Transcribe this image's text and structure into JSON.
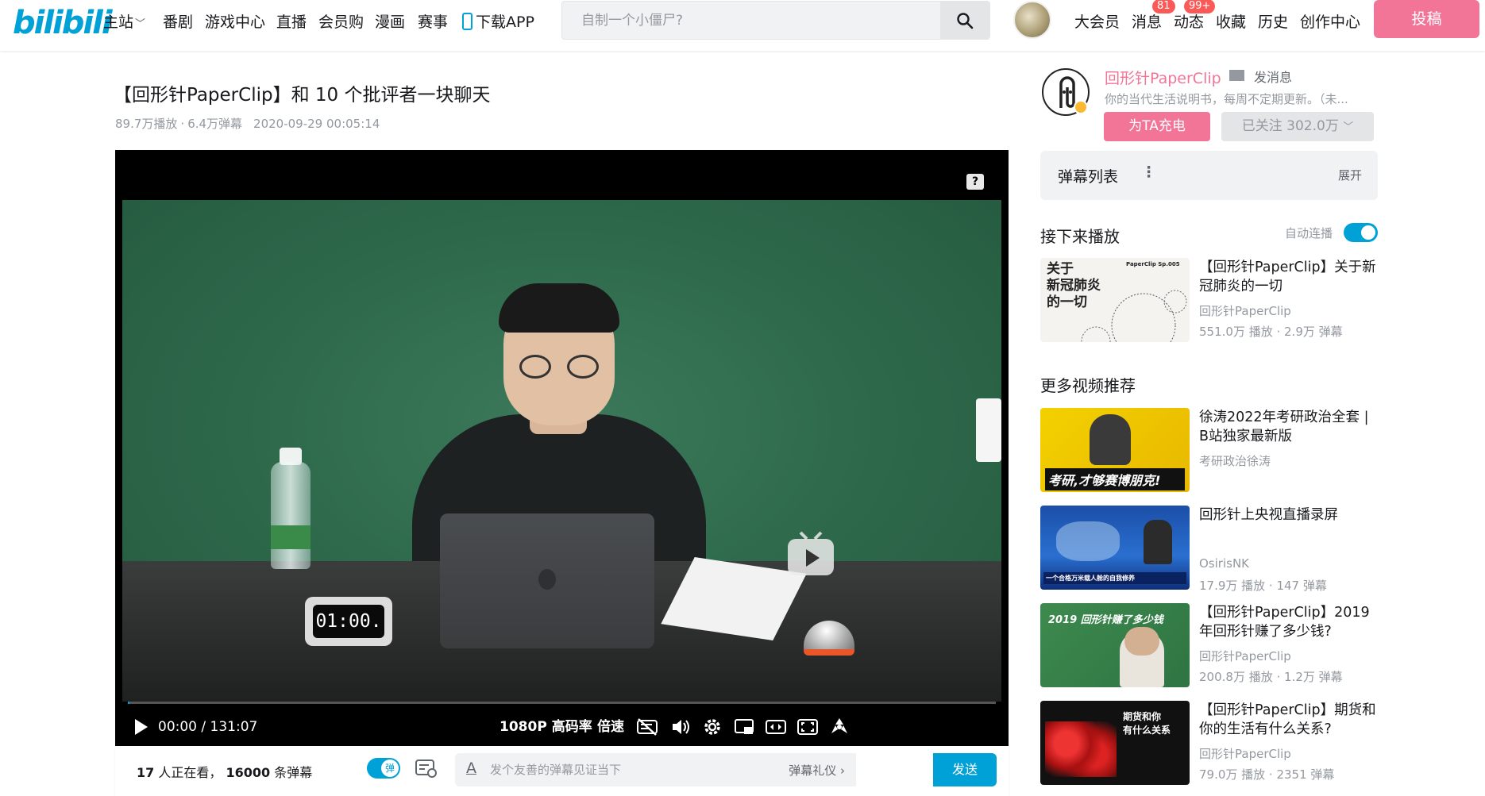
{
  "header": {
    "logo": "bilibili",
    "nav": [
      {
        "label": "主站",
        "has_caret": true
      },
      {
        "label": "番剧"
      },
      {
        "label": "游戏中心"
      },
      {
        "label": "直播"
      },
      {
        "label": "会员购"
      },
      {
        "label": "漫画"
      },
      {
        "label": "赛事"
      },
      {
        "label": "下载APP"
      }
    ],
    "search_placeholder": "自制一个小僵尸?",
    "right_nav": [
      {
        "label": "大会员"
      },
      {
        "label": "消息",
        "badge": "81"
      },
      {
        "label": "动态",
        "badge": "99+"
      },
      {
        "label": "收藏"
      },
      {
        "label": "历史"
      },
      {
        "label": "创作中心"
      }
    ],
    "upload_label": "投稿"
  },
  "video": {
    "title": "【回形针PaperClip】和 10 个批评者一块聊天",
    "views": "89.7万播放",
    "danmaku_count": "6.4万弹幕",
    "date": "2020-09-29 00:05:14"
  },
  "player": {
    "clock_display": "01:00.",
    "current_time": "00:00",
    "separator": "/",
    "duration": "131:07",
    "progress_fraction": 0.002,
    "quality": "1080P 高码率",
    "speed": "倍速",
    "help_icon": "?"
  },
  "danmaku_bar": {
    "viewers_count": "17",
    "viewers_text": "人正在看，",
    "danmaku_total": "16000",
    "danmaku_text": "条弹幕",
    "toggle_label": "弹",
    "placeholder": "发个友善的弹幕见证当下",
    "etiquette": "弹幕礼仪",
    "send_label": "发送",
    "accent": "#00a1d6"
  },
  "uploader": {
    "name": "回形针PaperClip",
    "message_label": "发消息",
    "description": "你的当代生活说明书，每周不定期更新。（未...",
    "charge_label": "为TA充电",
    "follow_label": "已关注 302.0万",
    "name_color": "#f27598"
  },
  "danmaku_list": {
    "title": "弹幕列表",
    "expand_label": "展开"
  },
  "up_next": {
    "section_title": "接下来播放",
    "autoplay_label": "自动连播",
    "autoplay_on": true,
    "item": {
      "title": "【回形针PaperClip】关于新冠肺炎的一切",
      "author": "回形针PaperClip",
      "stats": "551.0万 播放 · 2.9万 弹幕",
      "thumb_text": "关于\n新冠肺炎\n的一切",
      "thumb_tag": "PaperClip Sp.005"
    }
  },
  "recommendations": {
    "section_title": "更多视频推荐",
    "items": [
      {
        "title": "徐涛2022年考研政治全套 | B站独家最新版",
        "author": "考研政治徐涛",
        "stats": "",
        "thumb_text": "考研,才够赛博朋克!"
      },
      {
        "title": "回形针上央视直播录屏",
        "author": "OsirisNK",
        "stats": "17.9万 播放 · 147 弹幕",
        "thumb_text": "一个合格万米载人舱的自我修养"
      },
      {
        "title": "【回形针PaperClip】2019年回形针赚了多少钱?",
        "author": "回形针PaperClip",
        "stats": "200.8万 播放 · 1.2万 弹幕",
        "thumb_text": "2019 回形针赚了多少钱"
      },
      {
        "title": "【回形针PaperClip】期货和你的生活有什么关系?",
        "author": "回形针PaperClip",
        "stats": "79.0万 播放 · 2351 弹幕",
        "thumb_text": "期货和你\n有什么关系"
      }
    ]
  }
}
